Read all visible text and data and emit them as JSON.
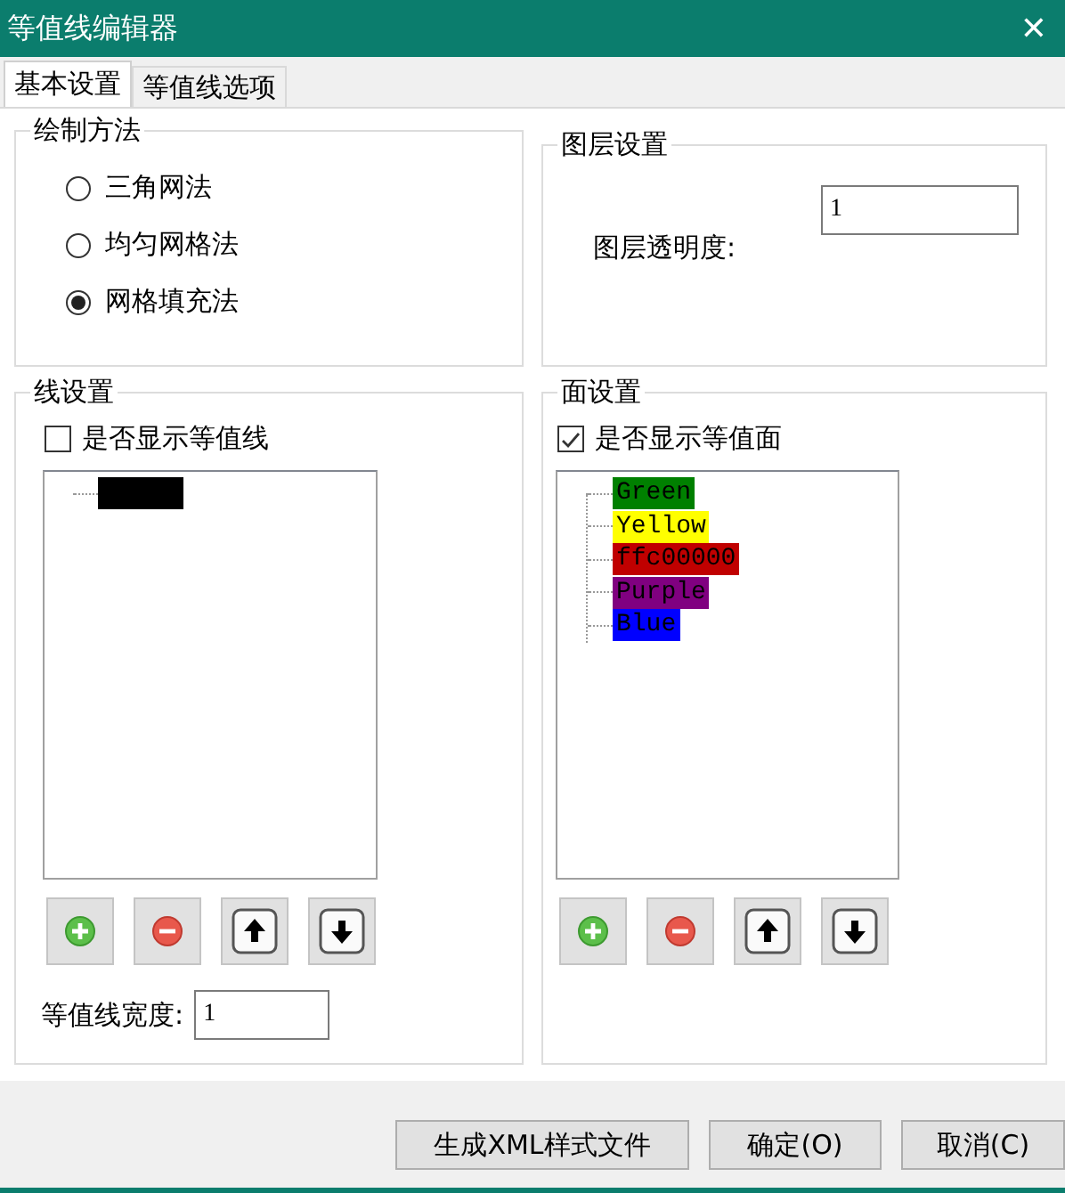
{
  "window": {
    "title": "等值线编辑器",
    "close": "✕"
  },
  "tabs": [
    {
      "label": "基本设置",
      "selected": true
    },
    {
      "label": "等值线选项",
      "selected": false
    }
  ],
  "draw_method": {
    "title": "绘制方法",
    "options": [
      {
        "label": "三角网法",
        "selected": false
      },
      {
        "label": "均匀网格法",
        "selected": false
      },
      {
        "label": "网格填充法",
        "selected": true
      }
    ]
  },
  "layer_settings": {
    "title": "图层设置",
    "opacity_label": "图层透明度:",
    "opacity_value": "1"
  },
  "line_settings": {
    "title": "线设置",
    "show_label": "是否显示等值线",
    "checked": false,
    "items": [
      {
        "color": "#000000"
      }
    ],
    "tools": [
      {
        "kind": "add"
      },
      {
        "kind": "remove"
      },
      {
        "kind": "up"
      },
      {
        "kind": "down"
      }
    ],
    "width_label": "等值线宽度:",
    "width_value": "1"
  },
  "surface_settings": {
    "title": "面设置",
    "show_label": "是否显示等值面",
    "checked": true,
    "items": [
      {
        "label": "Green",
        "color": "#008000"
      },
      {
        "label": "Yellow",
        "color": "#ffff00"
      },
      {
        "label": "ffc00000",
        "color": "#c00000"
      },
      {
        "label": "Purple",
        "color": "#800080"
      },
      {
        "label": "Blue",
        "color": "#0000ff"
      }
    ],
    "tools": [
      {
        "kind": "add"
      },
      {
        "kind": "remove"
      },
      {
        "kind": "up"
      },
      {
        "kind": "down"
      }
    ]
  },
  "buttons": [
    "生成XML样式文件",
    "确定(O)",
    "取消(C)"
  ]
}
